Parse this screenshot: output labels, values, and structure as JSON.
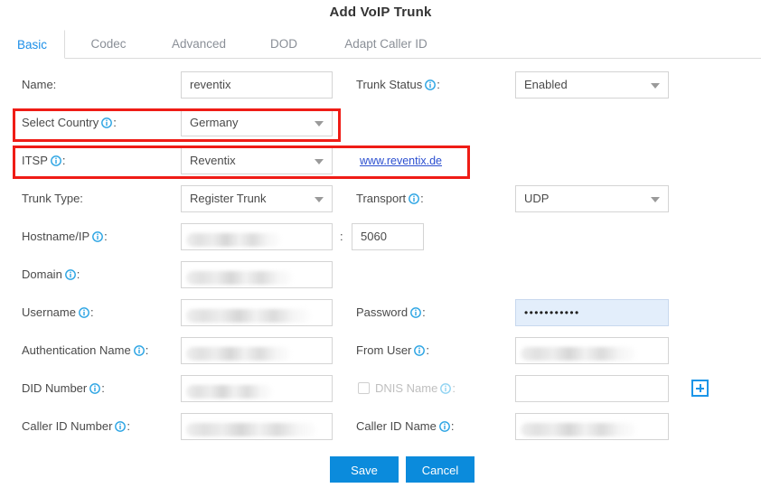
{
  "dialog": {
    "title": "Add VoIP Trunk"
  },
  "tabs": [
    {
      "label": "Basic",
      "active": true
    },
    {
      "label": "Codec",
      "active": false
    },
    {
      "label": "Advanced",
      "active": false
    },
    {
      "label": "DOD",
      "active": false
    },
    {
      "label": "Adapt Caller ID",
      "active": false
    }
  ],
  "fields": {
    "name": {
      "label": "Name:",
      "value": "reventix",
      "has_info": false
    },
    "trunk_status": {
      "label": "Trunk Status",
      "value": "Enabled",
      "has_info": true
    },
    "select_country": {
      "label": "Select Country",
      "value": "Germany",
      "has_info": true
    },
    "itsp": {
      "label": "ITSP",
      "value": "Reventix",
      "has_info": true
    },
    "itsp_link": {
      "label": "www.reventix.de"
    },
    "trunk_type": {
      "label": "Trunk Type:",
      "value": "Register Trunk",
      "has_info": false
    },
    "transport": {
      "label": "Transport",
      "value": "UDP",
      "has_info": true
    },
    "hostname_ip": {
      "label": "Hostname/IP",
      "value": "",
      "has_info": true,
      "redacted": true
    },
    "port": {
      "label": "",
      "value": "5060",
      "has_info": false
    },
    "port_separator": {
      "label": ":"
    },
    "domain": {
      "label": "Domain",
      "value": "",
      "has_info": true,
      "redacted": true
    },
    "username": {
      "label": "Username",
      "value": "",
      "has_info": true,
      "redacted": true
    },
    "password": {
      "label": "Password",
      "value": "•••••••••••",
      "has_info": true
    },
    "authentication_name": {
      "label": "Authentication Name",
      "value": "",
      "has_info": true,
      "redacted": true
    },
    "from_user": {
      "label": "From User",
      "value": "",
      "has_info": true,
      "redacted": true
    },
    "did_number": {
      "label": "DID Number",
      "value": "",
      "has_info": true,
      "redacted": true
    },
    "dnis_name": {
      "label": "DNIS Name",
      "value": "",
      "has_info": true,
      "checked": false,
      "disabled": true
    },
    "caller_id_number": {
      "label": "Caller ID Number",
      "value": "",
      "has_info": true,
      "redacted": true
    },
    "caller_id_name": {
      "label": "Caller ID Name",
      "value": "",
      "has_info": true,
      "redacted": true
    }
  },
  "buttons": {
    "save": "Save",
    "cancel": "Cancel",
    "add_dnis": "+"
  },
  "colors": {
    "accent_blue": "#0b8bdc",
    "tab_active": "#1c8fe8",
    "info_icon": "#29a3e3",
    "highlight_red": "#ef1c16",
    "link": "#2b4fd0",
    "autofill_bg": "#e3eefb"
  }
}
